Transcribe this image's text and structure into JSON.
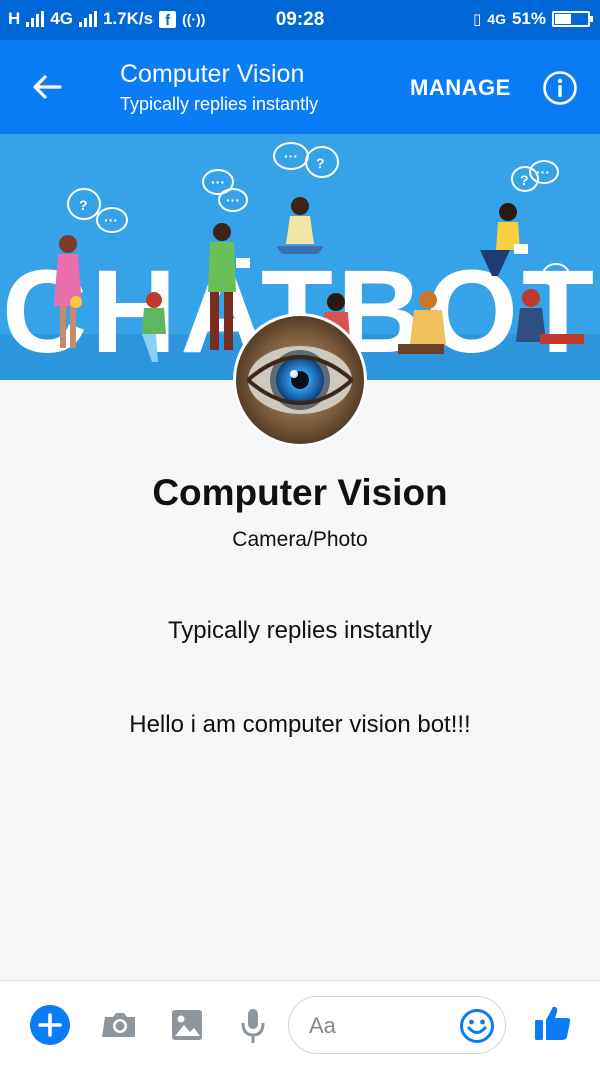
{
  "status_bar": {
    "network_left": "H",
    "network_4g": "4G",
    "speed": "1.7K/s",
    "time": "09:28",
    "network_right": "4G",
    "battery": "51%",
    "battery_level": 0.51
  },
  "header": {
    "title": "Computer Vision",
    "subtitle": "Typically replies instantly",
    "manage_label": "MANAGE"
  },
  "banner": {
    "text": "CHATBOT"
  },
  "profile": {
    "name": "Computer Vision",
    "category": "Camera/Photo",
    "response_time": "Typically replies instantly",
    "greeting": "Hello i am computer vision bot!!!"
  },
  "composer": {
    "placeholder": "Aa"
  },
  "colors": {
    "header_blue": "#0a7cf5",
    "status_blue": "#0067d6",
    "banner_blue": "#36a2e8"
  },
  "icons": [
    "back-arrow-icon",
    "info-icon",
    "plus-icon",
    "camera-icon",
    "image-icon",
    "microphone-icon",
    "emoji-icon",
    "thumbs-up-icon"
  ]
}
